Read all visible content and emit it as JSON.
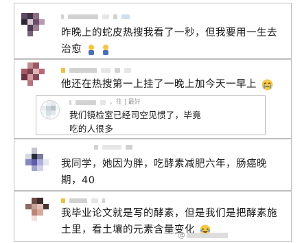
{
  "comments": [
    {
      "text_line1": "昨晚上的蛇皮热搜我看了一秒，但我要用一生去",
      "text_line2": "治愈",
      "emoji": [
        "person-emoji",
        "person-emoji"
      ]
    },
    {
      "text": "他还在热搜第一上挂了一晚上加今天一早上",
      "emoji": [
        "crying-emoji"
      ]
    },
    {
      "reply_meta": "、往 | 最好",
      "text_line1": "我们镜检室已经司空见惯了，毕竟",
      "text_line2": "吃的人很多"
    },
    {
      "text_line1": "我同学，她因为胖，吃酵素减肥六年，肠癌晚",
      "text_line2": "期，40"
    },
    {
      "text_line1": "我毕业论文就是写的酵素，但是我们是把酵素施",
      "text_line2": "土里，看土壤的元素含量变化",
      "emoji": [
        "laughing-emoji"
      ]
    }
  ],
  "watermark": "@",
  "colors": {
    "border": "#bdbdbd",
    "text": "#1a1a1a",
    "name_blur": "#d2d2d2"
  }
}
